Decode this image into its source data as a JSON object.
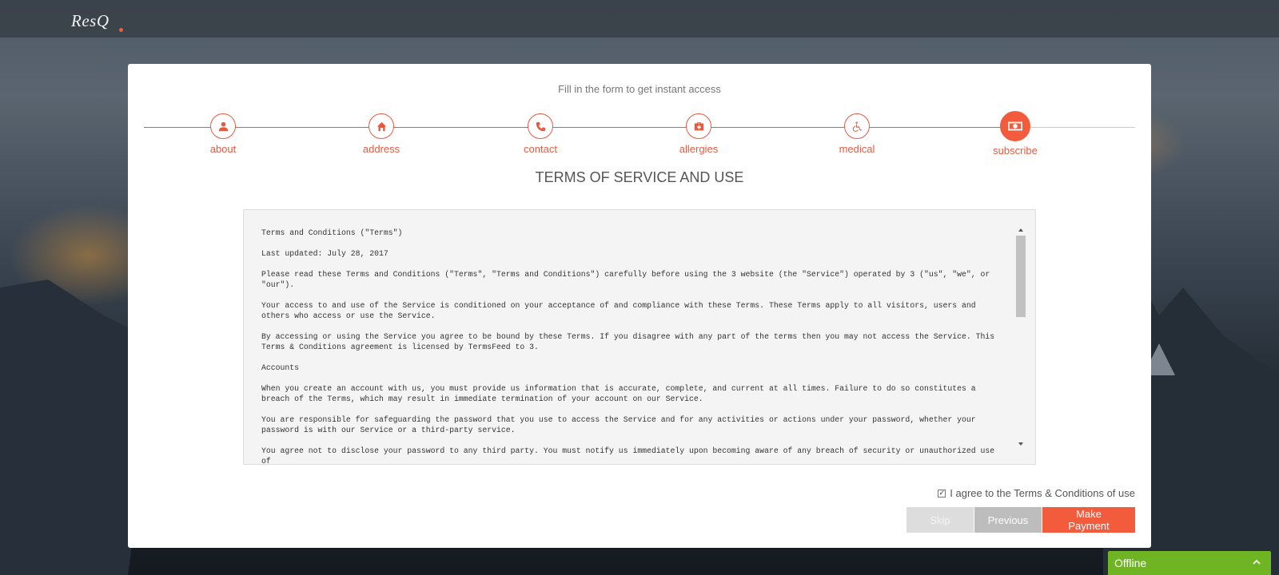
{
  "brand": {
    "name": "ResQ"
  },
  "form": {
    "subtitle": "Fill in the form to get instant access",
    "steps": [
      {
        "label": "about",
        "icon": "user-icon",
        "completed": true
      },
      {
        "label": "address",
        "icon": "home-icon",
        "completed": true
      },
      {
        "label": "contact",
        "icon": "phone-icon",
        "completed": true
      },
      {
        "label": "allergies",
        "icon": "medkit-icon",
        "completed": true
      },
      {
        "label": "medical",
        "icon": "wheelchair-icon",
        "completed": true
      },
      {
        "label": "subscribe",
        "icon": "money-icon",
        "active": true
      }
    ],
    "terms_title": "TERMS OF SERVICE AND USE",
    "terms_paragraphs": [
      "Terms and Conditions (\"Terms\")",
      "Last updated: July 28, 2017",
      "Please read these Terms and Conditions (\"Terms\", \"Terms and Conditions\") carefully before using the 3 website (the \"Service\") operated by 3 (\"us\", \"we\", or \"our\").",
      "Your access to and use of the Service is conditioned on your acceptance of and compliance with these Terms. These Terms apply to all visitors, users and others who access or use the Service.",
      "By accessing or using the Service you agree to be bound by these Terms. If you disagree with any part of the terms then you may not access the Service. This Terms & Conditions agreement is licensed by TermsFeed to 3.",
      "Accounts",
      "When you create an account with us, you must provide us information that is accurate, complete, and current at all times. Failure to do so constitutes a breach of the Terms, which may result in immediate termination of your account on our Service.",
      "You are responsible for safeguarding the password that you use to access the Service and for any activities or actions under your password, whether your password is with our Service or a third-party service.",
      "You agree not to disclose your password to any third party. You must notify us immediately upon becoming aware of any breach of security or unauthorized use of"
    ],
    "agree_label": "I agree to the Terms & Conditions of use",
    "agree_checked": true,
    "buttons": {
      "skip": "Skip",
      "previous": "Previous",
      "pay": "Make Payment"
    }
  },
  "chat": {
    "status": "Offline"
  },
  "colors": {
    "accent": "#f25c3c",
    "chat_green": "#6fb523"
  }
}
